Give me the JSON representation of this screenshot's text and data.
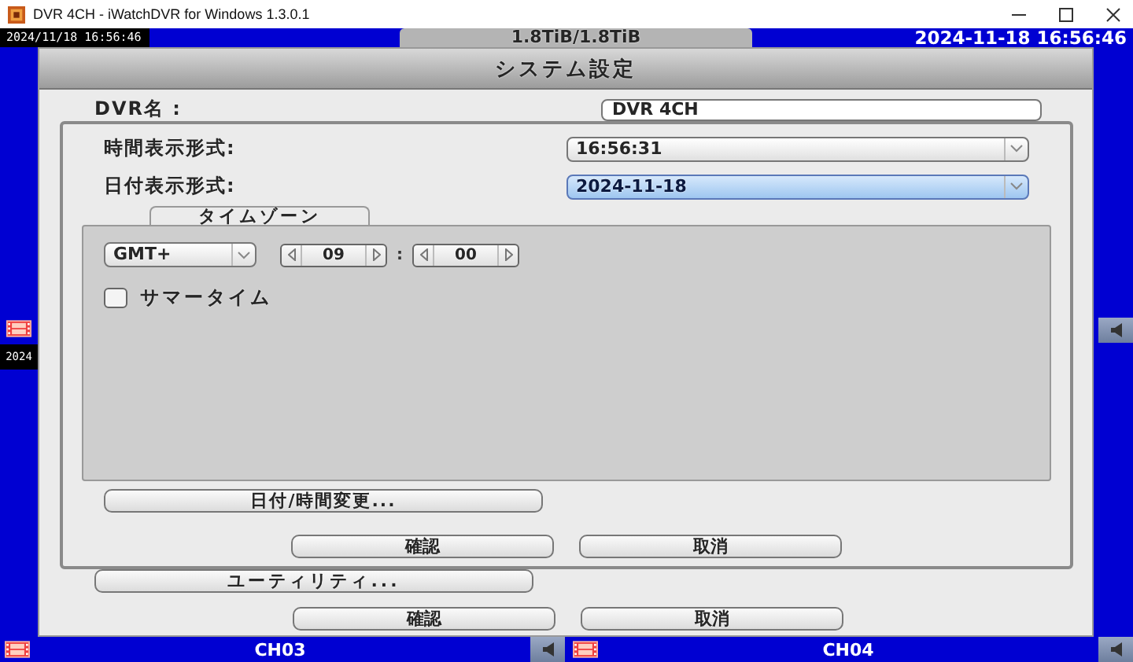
{
  "window": {
    "title": "DVR 4CH - iWatchDVR for Windows 1.3.0.1"
  },
  "dvr_background": {
    "left_timestamp": "2024/11/18 16:56:46",
    "storage": "1.8TiB/1.8TiB",
    "right_timestamp": "2024-11-18 16:56:46",
    "side_timestamp": "2024",
    "channels": [
      {
        "label": "CH03"
      },
      {
        "label": "CH04"
      }
    ]
  },
  "system_dialog": {
    "title": "システム設定",
    "dvr_name_label": "DVR名 :",
    "dvr_name_value": "DVR 4CH",
    "utility_button": "ユーティリティ...",
    "buttons": [
      "確認",
      "取消"
    ]
  },
  "datetime_dialog": {
    "fields": [
      {
        "label": "時間表示形式:",
        "value": "16:56:31",
        "selected": false
      },
      {
        "label": "日付表示形式:",
        "value": "2024-11-18",
        "selected": true
      }
    ],
    "timezone": {
      "title": "タイムゾーン",
      "zone": "GMT+",
      "hours": "09",
      "separator": ":",
      "minutes": "00",
      "dst": {
        "label": "サマータイム",
        "checked": false
      }
    },
    "change_button": "日付/時間変更...",
    "buttons": [
      "確認",
      "取消"
    ]
  }
}
